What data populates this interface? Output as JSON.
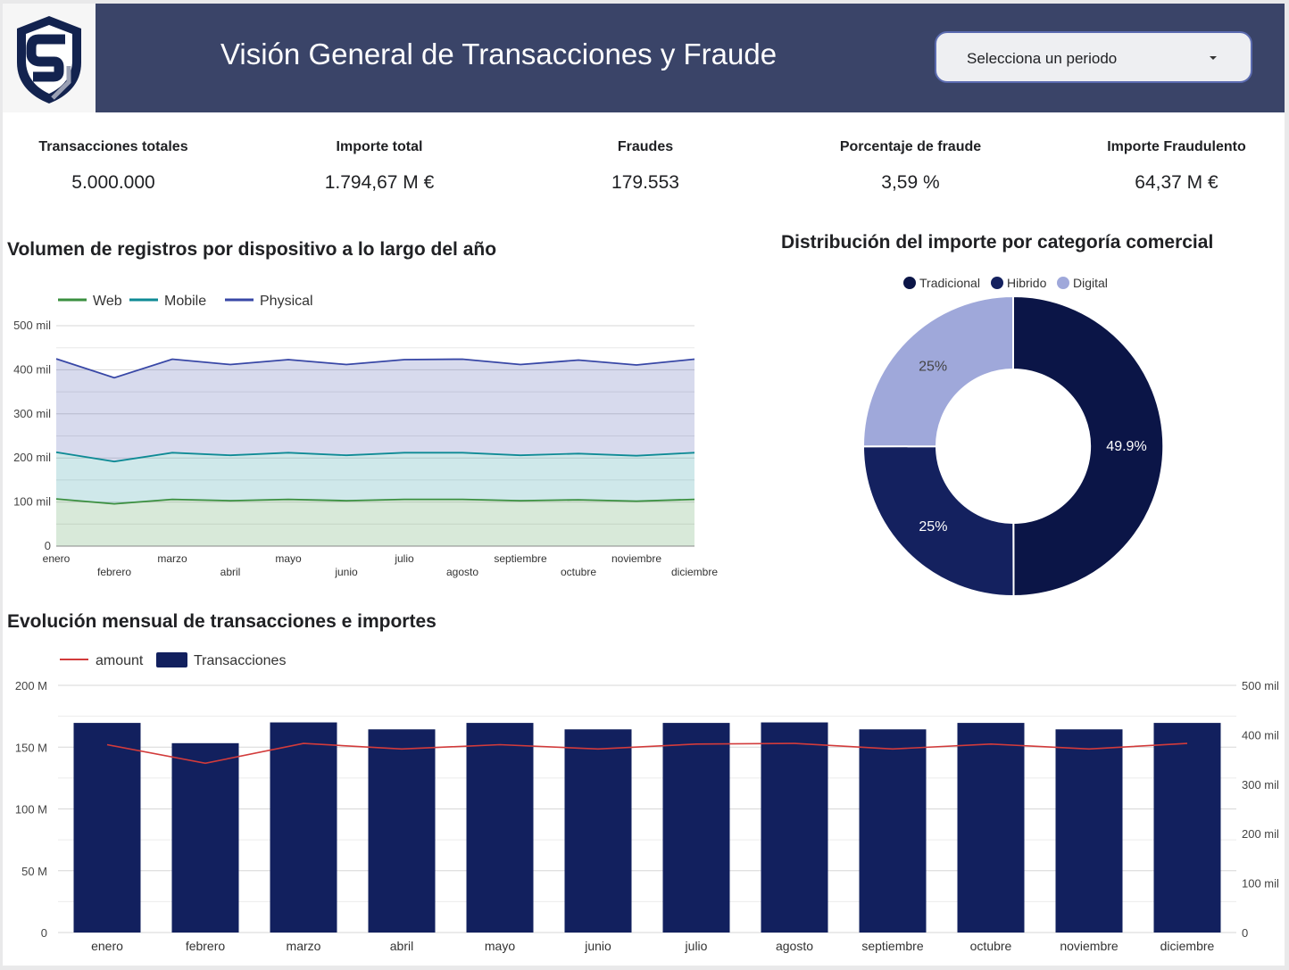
{
  "header": {
    "title": "Visión General de Transacciones y Fraude",
    "period_placeholder": "Selecciona un periodo",
    "logo_icon": "shield-s-logo"
  },
  "kpis": [
    {
      "label": "Transacciones totales",
      "value": "5.000.000"
    },
    {
      "label": "Importe total",
      "value": "1.794,67 M €"
    },
    {
      "label": "Fraudes",
      "value": "179.553"
    },
    {
      "label": "Porcentaje de fraude",
      "value": "3,59 %"
    },
    {
      "label": "Importe Fraudulento",
      "value": "64,37 M €"
    }
  ],
  "colors": {
    "header_bg": "#3a4468",
    "web": "#3a8f3f",
    "mobile": "#0e8a95",
    "physical": "#3847a6",
    "tradicional": "#0b1547",
    "hibrido": "#14215f",
    "digital": "#9fa8da",
    "bars": "#12205e",
    "amount_line": "#d23b3b"
  },
  "chart_data": [
    {
      "type": "area",
      "title": "Volumen de registros por dispositivo a lo largo del año",
      "stacked": true,
      "x": [
        "enero",
        "febrero",
        "marzo",
        "abril",
        "mayo",
        "junio",
        "julio",
        "agosto",
        "septiembre",
        "octubre",
        "noviembre",
        "diciembre"
      ],
      "series": [
        {
          "name": "Web",
          "values": [
            107000,
            96000,
            106000,
            103000,
            106000,
            103000,
            106000,
            106000,
            103000,
            105000,
            102000,
            106000
          ]
        },
        {
          "name": "Mobile",
          "values": [
            106000,
            96000,
            106000,
            103000,
            106000,
            103000,
            106000,
            106000,
            103000,
            105000,
            103000,
            106000
          ]
        },
        {
          "name": "Physical",
          "values": [
            212000,
            190000,
            212000,
            206000,
            211000,
            206000,
            211000,
            212000,
            206000,
            212000,
            206000,
            212000
          ]
        }
      ],
      "yticks": [
        "0",
        "100 mil",
        "200 mil",
        "300 mil",
        "400 mil",
        "500 mil"
      ],
      "ylim": [
        0,
        500000
      ],
      "legend": "top-left",
      "grid": true
    },
    {
      "type": "pie",
      "donut": true,
      "title": "Distribución del importe por categoría comercial",
      "categories": [
        "Tradicional",
        "Hibrido",
        "Digital"
      ],
      "values": [
        49.9,
        25,
        25
      ],
      "labels": [
        "49.9%",
        "25%",
        "25%"
      ],
      "legend": "top"
    },
    {
      "type": "bar",
      "title": "Evolución mensual de transacciones e importes",
      "categories": [
        "enero",
        "febrero",
        "marzo",
        "abril",
        "mayo",
        "junio",
        "julio",
        "agosto",
        "septiembre",
        "octubre",
        "noviembre",
        "diciembre"
      ],
      "series": [
        {
          "name": "Transacciones",
          "kind": "bar",
          "axis": "right",
          "values": [
            424000,
            383000,
            425000,
            411000,
            424000,
            411000,
            424000,
            425000,
            411000,
            424000,
            411000,
            424000
          ]
        },
        {
          "name": "amount",
          "kind": "line",
          "axis": "left",
          "values": [
            152000000,
            137000000,
            153000000,
            148500000,
            152000000,
            148500000,
            152500000,
            153000000,
            148500000,
            152500000,
            148500000,
            153000000
          ]
        }
      ],
      "yticks_left": [
        "0",
        "50 M",
        "100 M",
        "150 M",
        "200 M"
      ],
      "ylim_left": [
        0,
        200000000
      ],
      "yticks_right": [
        "0",
        "100 mil",
        "200 mil",
        "300 mil",
        "400 mil",
        "500 mil"
      ],
      "ylim_right": [
        0,
        500000
      ],
      "legend": "top-left",
      "grid": true
    }
  ]
}
